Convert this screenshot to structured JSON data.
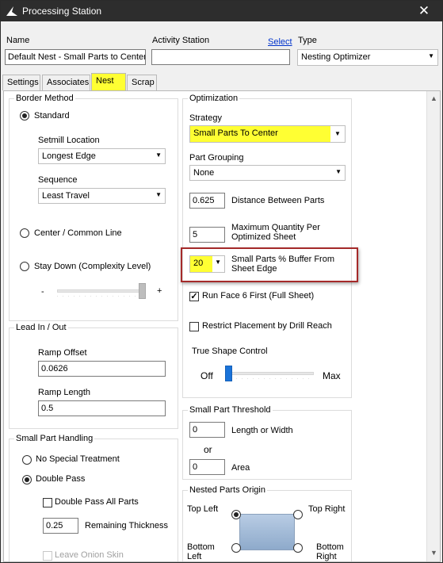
{
  "window": {
    "title": "Processing Station",
    "close_glyph": "✕"
  },
  "header": {
    "name_label": "Name",
    "name_value": "Default Nest - Small Parts to Center",
    "activity_label": "Activity Station",
    "activity_value": "",
    "select_link": "Select",
    "type_label": "Type",
    "type_value": "Nesting Optimizer"
  },
  "tabs": [
    {
      "label": "Settings",
      "active": false
    },
    {
      "label": "Associates",
      "active": false
    },
    {
      "label": "Nest",
      "active": true
    },
    {
      "label": "Scrap",
      "active": false
    }
  ],
  "border_method": {
    "title": "Border Method",
    "standard_label": "Standard",
    "setmill_label": "Setmill Location",
    "setmill_value": "Longest Edge",
    "sequence_label": "Sequence",
    "sequence_value": "Least Travel",
    "center_label": "Center / Common Line",
    "staydown_label": "Stay Down (Complexity Level)",
    "minus": "-",
    "plus": "+",
    "complexity_level_fraction": 1.0
  },
  "lead": {
    "title": "Lead In / Out",
    "ramp_offset_label": "Ramp Offset",
    "ramp_offset_value": "0.0626",
    "ramp_length_label": "Ramp Length",
    "ramp_length_value": "0.5"
  },
  "small_part_handling": {
    "title": "Small Part Handling",
    "no_special_label": "No Special Treatment",
    "double_pass_label": "Double Pass",
    "double_pass_all_label": "Double Pass All Parts",
    "remaining_value": "0.25",
    "remaining_label": "Remaining Thickness",
    "onion_label": "Leave Onion Skin"
  },
  "optimization": {
    "title": "Optimization",
    "strategy_label": "Strategy",
    "strategy_value": "Small Parts To Center",
    "grouping_label": "Part Grouping",
    "grouping_value": "None",
    "distance_value": "0.625",
    "distance_label": "Distance Between Parts",
    "maxqty_value": "5",
    "maxqty_label": "Maximum Quantity Per Optimized Sheet",
    "buffer_value": "20",
    "buffer_label": "Small Parts % Buffer From Sheet Edge",
    "runface_label": "Run Face 6 First (Full Sheet)",
    "restrict_label": "Restrict Placement by Drill Reach",
    "trueshape_label": "True Shape Control",
    "off_label": "Off",
    "max_label": "Max",
    "true_shape_fraction": 0.0
  },
  "threshold": {
    "title": "Small Part Threshold",
    "length_value": "0",
    "length_label": "Length or Width",
    "or_label": "or",
    "area_value": "0",
    "area_label": "Area"
  },
  "nested_origin": {
    "title": "Nested Parts Origin",
    "top_left": "Top Left",
    "top_right": "Top Right",
    "bottom_left": "Bottom Left",
    "bottom_right": "Bottom Right"
  },
  "colors": {
    "highlight": "#ffff33",
    "callout": "#a52a2a",
    "link": "#0033cc",
    "slider_blue": "#1a73d9"
  }
}
